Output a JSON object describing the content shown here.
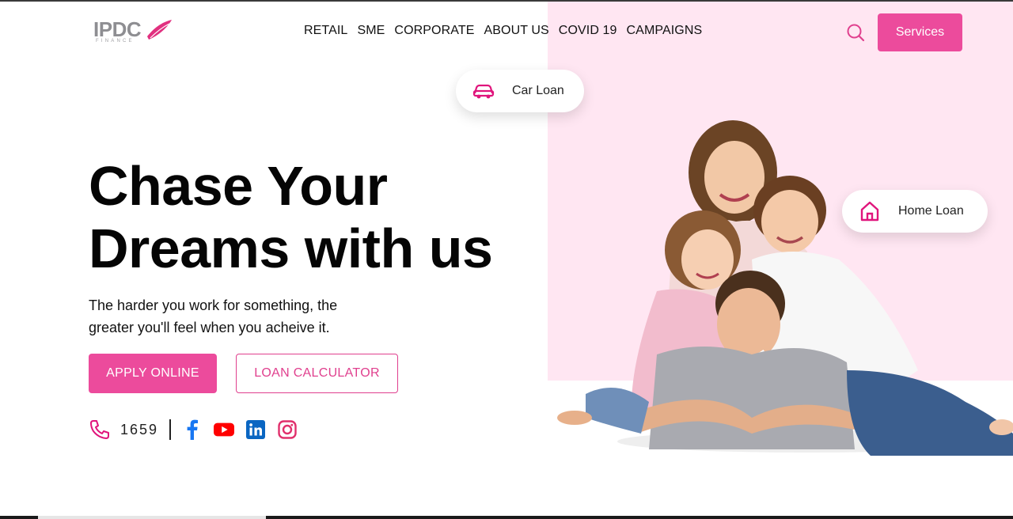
{
  "brand": {
    "name": "IPDC",
    "sub": "FINANCE",
    "accent": "#ec4b9c",
    "pink_bg": "#ffe6f2"
  },
  "nav": {
    "items": [
      {
        "label": "RETAIL"
      },
      {
        "label": "SME"
      },
      {
        "label": "CORPORATE"
      },
      {
        "label": "ABOUT US"
      },
      {
        "label": "COVID 19"
      },
      {
        "label": "CAMPAIGNS"
      }
    ]
  },
  "header": {
    "search_icon": "search-icon",
    "services_label": "Services"
  },
  "chips": {
    "car_loan": {
      "label": "Car Loan",
      "icon": "car-icon"
    },
    "home_loan": {
      "label": "Home Loan",
      "icon": "home-icon"
    }
  },
  "hero": {
    "title_line1": "Chase Your",
    "title_line2": "Dreams with us",
    "subtitle_line1": "The harder you work for something, the",
    "subtitle_line2": "greater you'll feel when you acheive it.",
    "apply_label": "APPLY ONLINE",
    "calculator_label": "LOAN CALCULATOR"
  },
  "contact": {
    "phone": "1659",
    "socials": [
      {
        "name": "facebook-icon",
        "color": "#1877f2"
      },
      {
        "name": "youtube-icon",
        "color": "#ff0000"
      },
      {
        "name": "linkedin-icon",
        "color": "#0a66c2"
      },
      {
        "name": "instagram-icon",
        "color": "#e1306c"
      }
    ]
  }
}
